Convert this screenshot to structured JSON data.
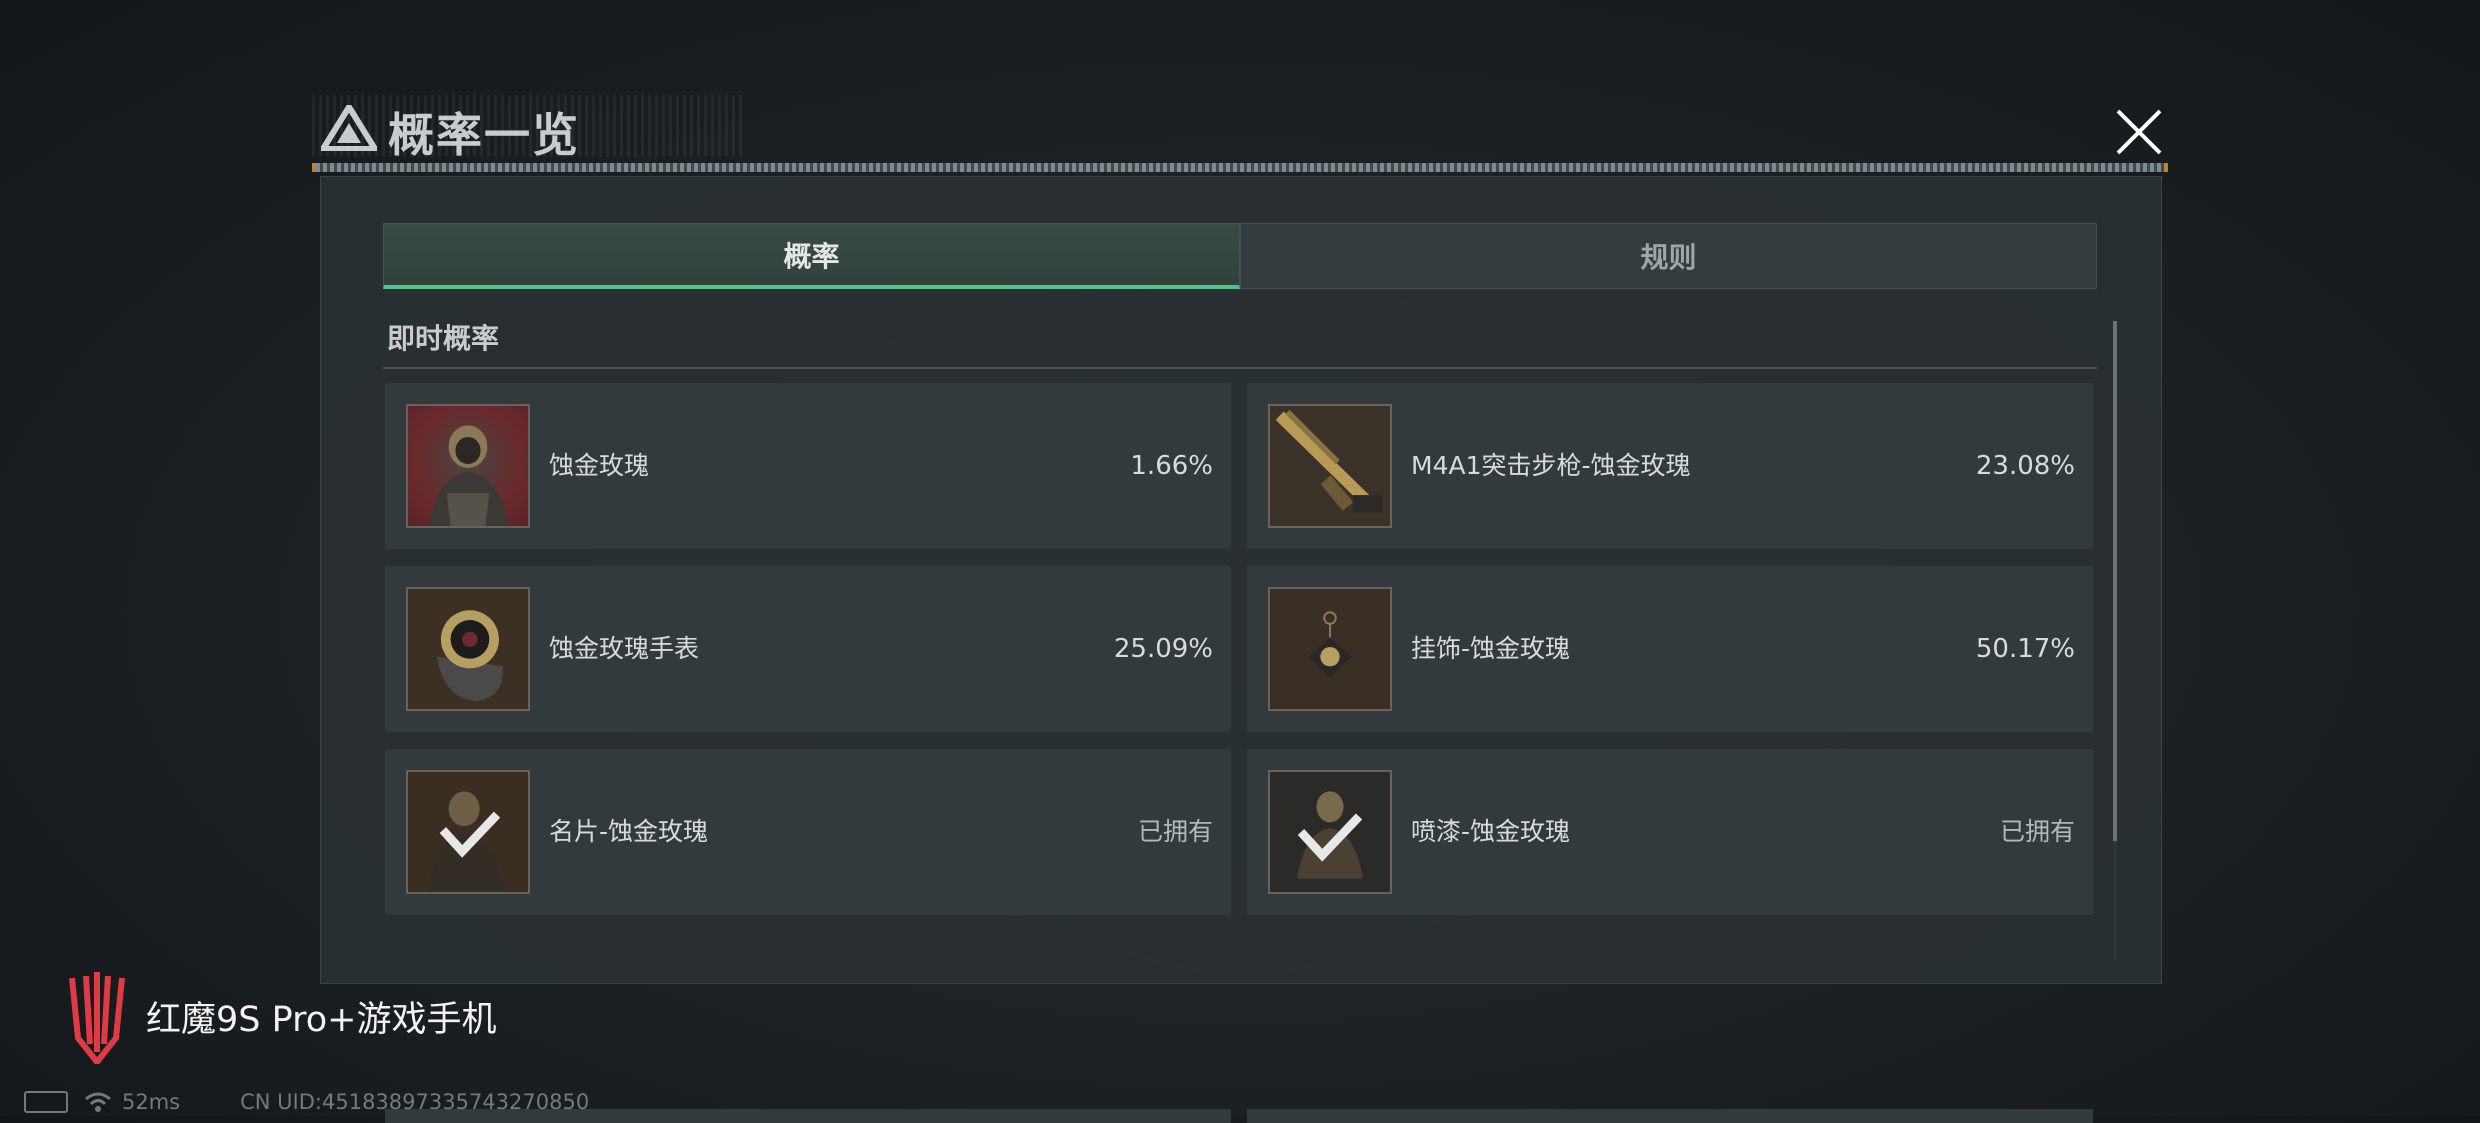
{
  "dialog": {
    "title": "概率一览",
    "close_icon": "close-icon"
  },
  "tabs": [
    {
      "label": "概率",
      "active": true
    },
    {
      "label": "规则",
      "active": false
    }
  ],
  "section": {
    "title": "即时概率"
  },
  "items": [
    {
      "name": "蚀金玫瑰",
      "value": "1.66%",
      "icon": "operator-skin-icon",
      "owned": false
    },
    {
      "name": "M4A1突击步枪-蚀金玫瑰",
      "value": "23.08%",
      "icon": "rifle-icon",
      "owned": false
    },
    {
      "name": "蚀金玫瑰手表",
      "value": "25.09%",
      "icon": "watch-icon",
      "owned": false
    },
    {
      "name": "挂饰-蚀金玫瑰",
      "value": "50.17%",
      "icon": "charm-icon",
      "owned": false
    },
    {
      "name": "名片-蚀金玫瑰",
      "value": "已拥有",
      "icon": "name-card-icon",
      "owned": true
    },
    {
      "name": "喷漆-蚀金玫瑰",
      "value": "已拥有",
      "icon": "spray-icon",
      "owned": true
    }
  ],
  "brand": {
    "text": "红魔9S Pro+游戏手机",
    "icon": "red-magic-logo-icon"
  },
  "status": {
    "ping": "52ms",
    "uid": "CN UID:45183897335743270850"
  },
  "colors": {
    "accent": "#4ec38a",
    "panel": "#2a3033",
    "card": "#333a3d",
    "brand_red": "#e03a44"
  }
}
